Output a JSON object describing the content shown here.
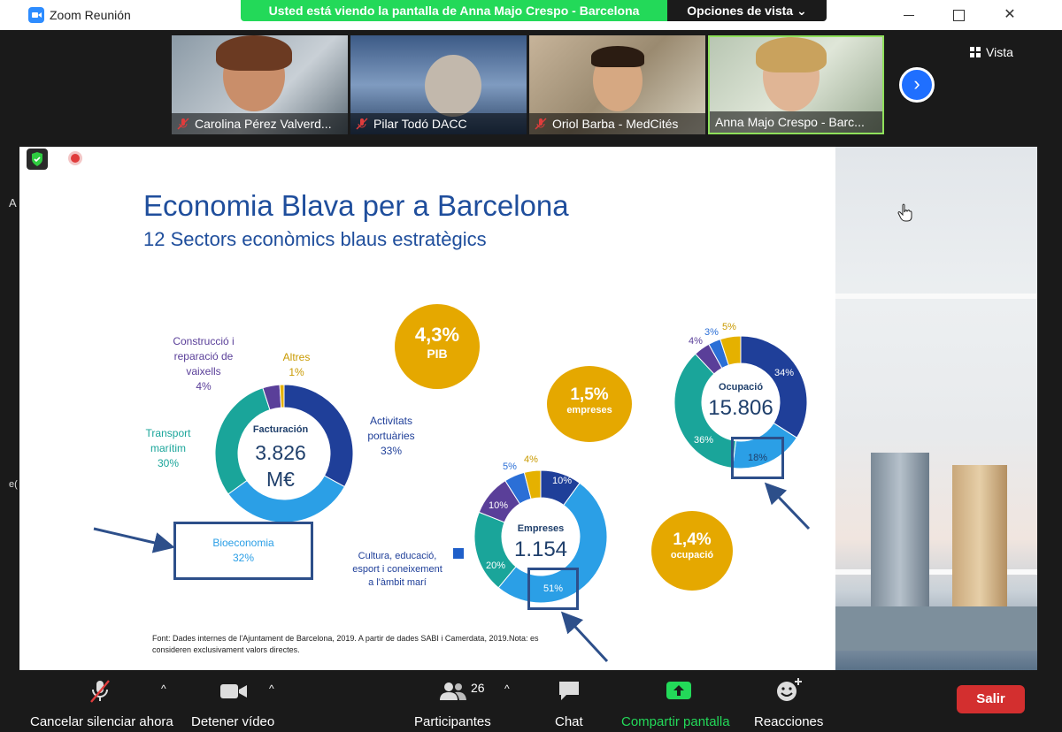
{
  "window": {
    "title": "Zoom Reunión",
    "share_banner": "Usted está viendo la pantalla de Anna Majo Crespo - Barcelona",
    "view_options": "Opciones de vista ⌄",
    "close_glyph": "✕"
  },
  "gallery": {
    "participants": [
      {
        "name": "Carolina Pérez Valverd..."
      },
      {
        "name": "Pilar Todó DACC"
      },
      {
        "name": "Oriol Barba - MedCités"
      },
      {
        "name": "Anna Majo Crespo - Barc..."
      }
    ],
    "next_glyph": "›",
    "view_label": "Vista"
  },
  "slide": {
    "title": "Economia Blava per a Barcelona",
    "subtitle": "12 Sectors econòmics blaus estratègics",
    "facturacio": {
      "center_label": "Facturación",
      "center_value_1": "3.826",
      "center_value_2": "M€",
      "segments": [
        {
          "name": "Activitats portuàries",
          "pct": 33,
          "color": "#1f3f99"
        },
        {
          "name": "Bioeconomia",
          "pct": 32,
          "color": "#2b9fe6"
        },
        {
          "name": "Transport marítim",
          "pct": 30,
          "color": "#1aa59a"
        },
        {
          "name": "Construcció i reparació de vaixells",
          "pct": 4,
          "color": "#5a3f99"
        },
        {
          "name": "Altres",
          "pct": 1,
          "color": "#e5b100"
        }
      ],
      "labels": {
        "construccio_1": "Construcció i",
        "construccio_2": "reparació de",
        "construccio_3": "vaixells",
        "construccio_pct": "4%",
        "altres": "Altres",
        "altres_pct": "1%",
        "activitats_1": "Activitats",
        "activitats_2": "portuàries",
        "activitats_pct": "33%",
        "transport_1": "Transport",
        "transport_2": "marítim",
        "transport_pct": "30%",
        "bio": "Bioeconomia",
        "bio_pct": "32%"
      }
    },
    "pib": {
      "value": "4,3%",
      "label": "PIB"
    },
    "empreses_bubble": {
      "value": "1,5%",
      "label": "empreses"
    },
    "ocupacio_bubble": {
      "value": "1,4%",
      "label": "ocupació"
    },
    "empreses": {
      "center_label": "Empreses",
      "center_value": "1.154",
      "segments": [
        {
          "pct": 10,
          "color": "#1f3f99"
        },
        {
          "pct": 51,
          "color": "#2b9fe6"
        },
        {
          "pct": 20,
          "color": "#1aa59a"
        },
        {
          "pct": 10,
          "color": "#5a3f99"
        },
        {
          "pct": 5,
          "color": "#2b6fd6"
        },
        {
          "pct": 4,
          "color": "#e5b100"
        }
      ],
      "labels": {
        "p10a": "10%",
        "p51": "51%",
        "p20": "20%",
        "p10b": "10%",
        "p5": "5%",
        "p4": "4%"
      },
      "legend_1": "Cultura, educació,",
      "legend_2": "esport i coneixement",
      "legend_3": "a l'àmbit marí"
    },
    "ocupacio": {
      "center_label": "Ocupació",
      "center_value": "15.806",
      "segments": [
        {
          "pct": 34,
          "color": "#1f3f99"
        },
        {
          "pct": 18,
          "color": "#2b9fe6"
        },
        {
          "pct": 36,
          "color": "#1aa59a"
        },
        {
          "pct": 4,
          "color": "#5a3f99"
        },
        {
          "pct": 3,
          "color": "#2b6fd6"
        },
        {
          "pct": 5,
          "color": "#e5b100"
        }
      ],
      "labels": {
        "p34": "34%",
        "p18": "18%",
        "p36": "36%",
        "p4": "4%",
        "p3": "3%",
        "p5": "5%"
      }
    },
    "footnote": "Font: Dades internes de l'Ajuntament de Barcelona, 2019. A partir de dades SABI i Camerdata, 2019.Nota: es consideren exclusivament valors directes."
  },
  "side": {
    "edge_a": "A",
    "edge_b": "e("
  },
  "toolbar": {
    "unmute": "Cancelar silenciar ahora",
    "stop_video": "Detener vídeo",
    "participants": "Participantes",
    "participants_count": "26",
    "chat": "Chat",
    "share": "Compartir pantalla",
    "reactions": "Reacciones",
    "leave": "Salir",
    "caret": "^"
  }
}
